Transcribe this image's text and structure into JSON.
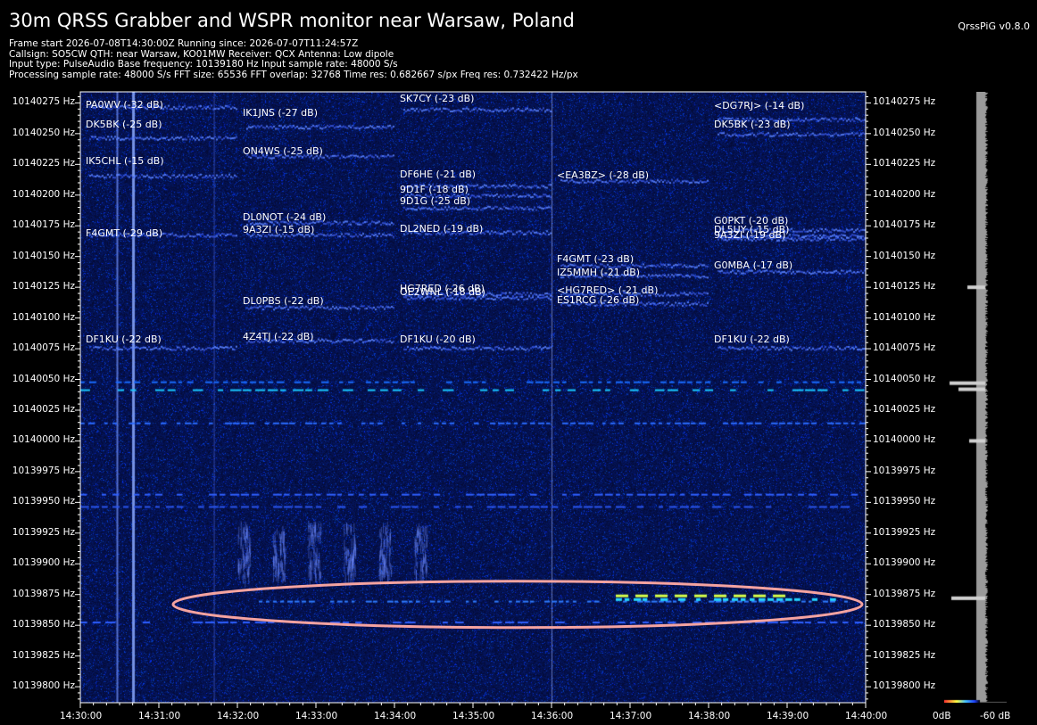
{
  "header": {
    "title": "30m QRSS Grabber and WSPR monitor near Warsaw, Poland",
    "version": "QrssPiG v0.8.0",
    "info_lines": [
      "Frame start 2026-07-08T14:30:00Z Running since: 2026-07-07T11:24:57Z",
      "Callsign: SO5CW QTH: near Warsaw, KO01MW Receiver: QCX Antenna: Low dipole",
      "Input type: PulseAudio Base frequency: 10139180 Hz Input sample rate: 48000 S/s",
      "Processing sample rate: 48000 S/s FFT size: 65536 FFT overlap: 32768 Time res: 0.682667 s/px Freq res: 0.732422 Hz/px"
    ]
  },
  "y_axis": {
    "unit": "Hz",
    "freq_min": 10139787,
    "freq_max": 10140284,
    "ticks": [
      "10140275 Hz",
      "10140250 Hz",
      "10140225 Hz",
      "10140200 Hz",
      "10140175 Hz",
      "10140150 Hz",
      "10140125 Hz",
      "10140100 Hz",
      "10140075 Hz",
      "10140050 Hz",
      "10140025 Hz",
      "10140000 Hz",
      "10139975 Hz",
      "10139950 Hz",
      "10139925 Hz",
      "10139900 Hz",
      "10139875 Hz",
      "10139850 Hz",
      "10139825 Hz",
      "10139800 Hz"
    ],
    "tick_values": [
      10140275,
      10140250,
      10140225,
      10140200,
      10140175,
      10140150,
      10140125,
      10140100,
      10140075,
      10140050,
      10140025,
      10140000,
      10139975,
      10139950,
      10139925,
      10139900,
      10139875,
      10139850,
      10139825,
      10139800
    ]
  },
  "x_axis": {
    "ticks": [
      "14:30:00",
      "14:31:00",
      "14:32:00",
      "14:33:00",
      "14:34:00",
      "14:35:00",
      "14:36:00",
      "14:37:00",
      "14:38:00",
      "14:39:00",
      "14:40:00"
    ],
    "minutes_span": 10
  },
  "wspr_spots": [
    {
      "text": "PA0WV (-32 dB)",
      "minute": 0,
      "freq": 10140272,
      "freq_line": 10140272
    },
    {
      "text": "DK5BK (-25 dB)",
      "minute": 0,
      "freq": 10140256,
      "freq_line": 10140247
    },
    {
      "text": "IK5CHL (-15 dB)",
      "minute": 0,
      "freq": 10140226,
      "freq_line": 10140216
    },
    {
      "text": "F4GMT (-29 dB)",
      "minute": 0,
      "freq": 10140167,
      "freq_line": 10140168
    },
    {
      "text": "DF1KU (-22 dB)",
      "minute": 0,
      "freq": 10140081,
      "freq_line": 10140076
    },
    {
      "text": "IK1JNS (-27 dB)",
      "minute": 2,
      "freq": 10140265,
      "freq_line": 10140256
    },
    {
      "text": "ON4WS (-25 dB)",
      "minute": 2,
      "freq": 10140234,
      "freq_line": 10140232
    },
    {
      "text": "DL0NOT (-24 dB)",
      "minute": 2,
      "freq": 10140180,
      "freq_line": 10140178
    },
    {
      "text": "9A3ZI (-15 dB)",
      "minute": 2,
      "freq": 10140170,
      "freq_line": 10140168
    },
    {
      "text": "DL0PBS (-22 dB)",
      "minute": 2,
      "freq": 10140112,
      "freq_line": 10140109
    },
    {
      "text": "4Z4TJ (-22 dB)",
      "minute": 2,
      "freq": 10140083,
      "freq_line": 10140082
    },
    {
      "text": "SK7CY (-23 dB)",
      "minute": 4,
      "freq": 10140277,
      "freq_line": 10140270
    },
    {
      "text": "DF6HE (-21 dB)",
      "minute": 4,
      "freq": 10140215,
      "freq_line": 10140208
    },
    {
      "text": "9D1F (-18 dB)",
      "minute": 4,
      "freq": 10140203,
      "freq_line": 10140200
    },
    {
      "text": "9D1G (-25 dB)",
      "minute": 4,
      "freq": 10140193,
      "freq_line": 10140190
    },
    {
      "text": "DL2NED (-19 dB)",
      "minute": 4,
      "freq": 10140171,
      "freq_line": 10140170
    },
    {
      "text": "HG7RED (-26 dB)",
      "minute": 4,
      "freq": 10140122,
      "freq_line": 10140120
    },
    {
      "text": "OE2WNL (-18 dB)",
      "minute": 4,
      "freq": 10140119,
      "freq_line": 10140117
    },
    {
      "text": "DF1KU (-20 dB)",
      "minute": 4,
      "freq": 10140081,
      "freq_line": 10140076
    },
    {
      "text": "<EA3BZ> (-28 dB)",
      "minute": 6,
      "freq": 10140214,
      "freq_line": 10140212
    },
    {
      "text": "F4GMT (-23 dB)",
      "minute": 6,
      "freq": 10140146,
      "freq_line": 10140143
    },
    {
      "text": "IZ5MMH (-21 dB)",
      "minute": 6,
      "freq": 10140135,
      "freq_line": 10140135
    },
    {
      "text": "<HG7RED> (-21 dB)",
      "minute": 6,
      "freq": 10140121,
      "freq_line": 10140120
    },
    {
      "text": "ES1RCG (-26 dB)",
      "minute": 6,
      "freq": 10140113,
      "freq_line": 10140112
    },
    {
      "text": "<DG7RJ> (-14 dB)",
      "minute": 8,
      "freq": 10140271,
      "freq_line": 10140262
    },
    {
      "text": "DK5BK (-23 dB)",
      "minute": 8,
      "freq": 10140256,
      "freq_line": 10140250
    },
    {
      "text": "G0PKT (-20 dB)",
      "minute": 8,
      "freq": 10140177,
      "freq_line": 10140172
    },
    {
      "text": "DL5UY (-15 dB)",
      "minute": 8,
      "freq": 10140170,
      "freq_line": 10140167
    },
    {
      "text": "9A3ZI (-19 dB)",
      "minute": 8,
      "freq": 10140166,
      "freq_line": 10140165
    },
    {
      "text": "G0MBA (-17 dB)",
      "minute": 8,
      "freq": 10140141,
      "freq_line": 10140138
    },
    {
      "text": "DF1KU (-22 dB)",
      "minute": 8,
      "freq": 10140081,
      "freq_line": 10140076
    }
  ],
  "legend": {
    "left": "0dB",
    "right": "-60 dB"
  },
  "colors": {
    "background": "#000000",
    "waterfall": "#0a1050",
    "annotation_ellipse": "#f5a3a0"
  }
}
